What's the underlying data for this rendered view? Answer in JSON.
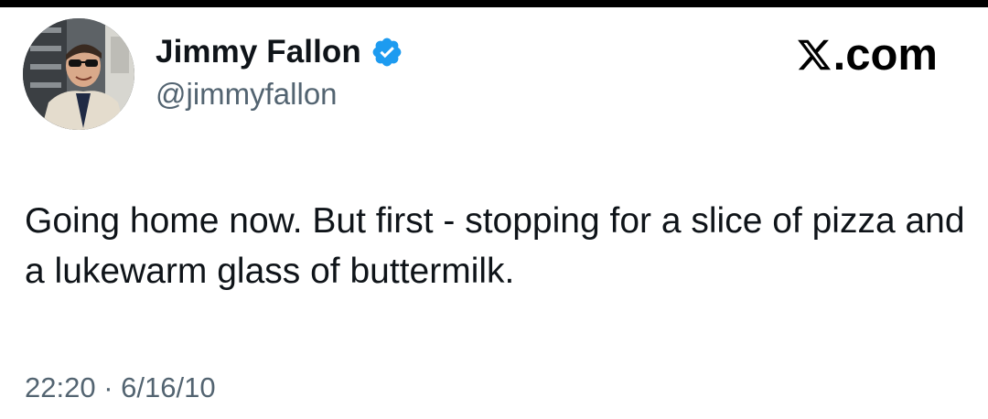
{
  "tweet": {
    "display_name": "Jimmy Fallon",
    "handle": "@jimmyfallon",
    "verified": true,
    "text": "Going home now. But first - stopping for a slice of pizza and a lukewarm glass of buttermilk.",
    "time": "22:20",
    "separator": "·",
    "date": "6/16/10"
  },
  "brand": {
    "suffix": ".com",
    "icon": "x-logo-icon"
  },
  "colors": {
    "verified_blue": "#1d9bf0",
    "text_primary": "#0f1419",
    "text_secondary": "#536471",
    "top_bar": "#000000"
  }
}
